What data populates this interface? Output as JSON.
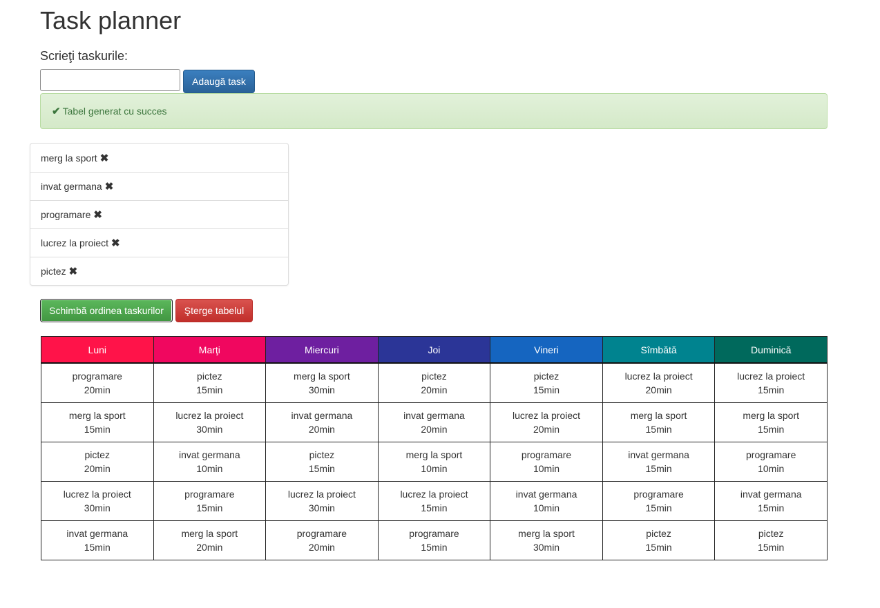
{
  "header": {
    "title": "Task planner",
    "input_label": "Scrieţi taskurile:"
  },
  "input": {
    "value": "",
    "placeholder": ""
  },
  "buttons": {
    "add": "Adaugă task",
    "shuffle": "Schimbă ordinea taskurilor",
    "delete": "Şterge tabelul"
  },
  "alert": {
    "icon": "check-icon",
    "text": "Tabel generat cu succes"
  },
  "tasks": [
    {
      "label": "merg la sport",
      "remove_icon": "✖"
    },
    {
      "label": "invat germana",
      "remove_icon": "✖"
    },
    {
      "label": "programare",
      "remove_icon": "✖"
    },
    {
      "label": "lucrez la proiect",
      "remove_icon": "✖"
    },
    {
      "label": "pictez",
      "remove_icon": "✖"
    }
  ],
  "schedule": {
    "days": [
      {
        "name": "Luni",
        "color": "#ff1349"
      },
      {
        "name": "Marţi",
        "color": "#f0075f"
      },
      {
        "name": "Miercuri",
        "color": "#6e1fa0"
      },
      {
        "name": "Joi",
        "color": "#2b3597"
      },
      {
        "name": "Vineri",
        "color": "#1565c0"
      },
      {
        "name": "Sîmbătă",
        "color": "#00838f"
      },
      {
        "name": "Duminică",
        "color": "#00695c"
      }
    ],
    "rows": [
      [
        {
          "task": "programare",
          "duration": "20min"
        },
        {
          "task": "pictez",
          "duration": "15min"
        },
        {
          "task": "merg la sport",
          "duration": "30min"
        },
        {
          "task": "pictez",
          "duration": "20min"
        },
        {
          "task": "pictez",
          "duration": "15min"
        },
        {
          "task": "lucrez la proiect",
          "duration": "20min"
        },
        {
          "task": "lucrez la proiect",
          "duration": "15min"
        }
      ],
      [
        {
          "task": "merg la sport",
          "duration": "15min"
        },
        {
          "task": "lucrez la proiect",
          "duration": "30min"
        },
        {
          "task": "invat germana",
          "duration": "20min"
        },
        {
          "task": "invat germana",
          "duration": "20min"
        },
        {
          "task": "lucrez la proiect",
          "duration": "20min"
        },
        {
          "task": "merg la sport",
          "duration": "15min"
        },
        {
          "task": "merg la sport",
          "duration": "15min"
        }
      ],
      [
        {
          "task": "pictez",
          "duration": "20min"
        },
        {
          "task": "invat germana",
          "duration": "10min"
        },
        {
          "task": "pictez",
          "duration": "15min"
        },
        {
          "task": "merg la sport",
          "duration": "10min"
        },
        {
          "task": "programare",
          "duration": "10min"
        },
        {
          "task": "invat germana",
          "duration": "15min"
        },
        {
          "task": "programare",
          "duration": "10min"
        }
      ],
      [
        {
          "task": "lucrez la proiect",
          "duration": "30min"
        },
        {
          "task": "programare",
          "duration": "15min"
        },
        {
          "task": "lucrez la proiect",
          "duration": "30min"
        },
        {
          "task": "lucrez la proiect",
          "duration": "15min"
        },
        {
          "task": "invat germana",
          "duration": "10min"
        },
        {
          "task": "programare",
          "duration": "15min"
        },
        {
          "task": "invat germana",
          "duration": "15min"
        }
      ],
      [
        {
          "task": "invat germana",
          "duration": "15min"
        },
        {
          "task": "merg la sport",
          "duration": "20min"
        },
        {
          "task": "programare",
          "duration": "20min"
        },
        {
          "task": "programare",
          "duration": "15min"
        },
        {
          "task": "merg la sport",
          "duration": "30min"
        },
        {
          "task": "pictez",
          "duration": "15min"
        },
        {
          "task": "pictez",
          "duration": "15min"
        }
      ]
    ]
  }
}
